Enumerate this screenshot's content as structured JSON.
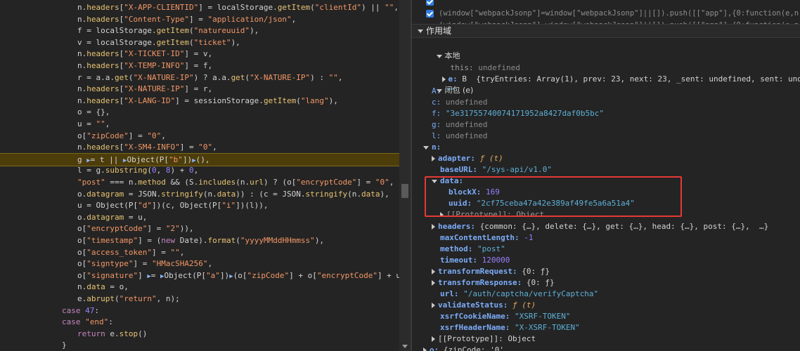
{
  "code": {
    "lines": [
      {
        "indent": 110,
        "text": "n.headers[\"X-APP-CLIENTID\"] = localStorage.getItem(\"clientId\") || \"\","
      },
      {
        "indent": 110,
        "text": "n.headers[\"Content-Type\"] = \"application/json\","
      },
      {
        "indent": 110,
        "text": "f = localStorage.getItem(\"natureuuid\"),"
      },
      {
        "indent": 110,
        "text": "v = localStorage.getItem(\"ticket\"),"
      },
      {
        "indent": 110,
        "text": "n.headers[\"X-TICKET-ID\"] = v,"
      },
      {
        "indent": 110,
        "text": "n.headers[\"X-TEMP-INFO\"] = f,"
      },
      {
        "indent": 110,
        "text": "r = a.a.get(\"X-NATURE-IP\") ? a.a.get(\"X-NATURE-IP\") : \"\","
      },
      {
        "indent": 110,
        "text": "n.headers[\"X-NATURE-IP\"] = r,"
      },
      {
        "indent": 110,
        "text": "n.headers[\"X-LANG-ID\"] = sessionStorage.getItem(\"lang\"),"
      },
      {
        "indent": 110,
        "text": "o = {},"
      },
      {
        "indent": 110,
        "text": "u = \"\","
      },
      {
        "indent": 110,
        "text": "o[\"zipCode\"] = \"0\","
      },
      {
        "indent": 110,
        "text": "n.headers[\"X-SM4-INFO\"] = \"0\","
      },
      {
        "indent": 110,
        "text": "g ▶= t || ▶Object(P[\"b\"])▶(),",
        "highlight": true
      },
      {
        "indent": 110,
        "text": "l = g.substring(0, 8) + 0,"
      },
      {
        "indent": 110,
        "text": "\"post\" === n.method && (S.includes(n.url) ? (o[\"encryptCode\"] = \"0\","
      },
      {
        "indent": 110,
        "text": "o.datagram = JSON.stringify(n.data)) : (c = JSON.stringify(n.data),"
      },
      {
        "indent": 110,
        "text": "u = Object(P[\"d\"])(c, Object(P[\"i\"])(l)),"
      },
      {
        "indent": 110,
        "text": "o.datagram = u,"
      },
      {
        "indent": 110,
        "text": "o[\"encryptCode\"] = \"2\")),"
      },
      {
        "indent": 110,
        "text": "o[\"timestamp\"] = (new Date).format(\"yyyyMMddHHmmss\"),"
      },
      {
        "indent": 110,
        "text": "o[\"access_token\"] = \"\","
      },
      {
        "indent": 110,
        "text": "o[\"signtype\"] = \"HMacSHA256\","
      },
      {
        "indent": 110,
        "text": "o[\"signature\"] ▶= ▶Object(P[\"a\"])▶(o[\"zipCode\"] + o[\"encryptCode\"] + u + o"
      },
      {
        "indent": 110,
        "text": "n.data = o,"
      },
      {
        "indent": 110,
        "text": "e.abrupt(\"return\", n);"
      },
      {
        "indent": 88,
        "text": "case 47:"
      },
      {
        "indent": 88,
        "text": "case \"end\":"
      },
      {
        "indent": 110,
        "text": "return e.stop()"
      },
      {
        "indent": 88,
        "text": "}"
      }
    ]
  },
  "breakpoints": [
    "(window[\"webpackJsonp\"]=window[\"webpackJsonp\"]||[]).push([[\"app\"],{0:function(e,n,A){e",
    "(window[\"webpackJsonp\"]=window[\"webpackJsonp\"]||[]).push([[\"app\"],{0:function(e,n,A){e"
  ],
  "scope": {
    "header": "作用域",
    "local": {
      "label": "本地",
      "this_key": "this:",
      "this_val": "undefined",
      "e_key": "e:",
      "e_val": "B  {tryEntries: Array(1), prev: 23, next: 23, _sent: undefined, sent: undefined,  …"
    },
    "closure": {
      "label": "闭包 (e)",
      "A_key": "A:",
      "A_val": "\"\"",
      "c_key": "c:",
      "c_val": "undefined",
      "f_key": "f:",
      "f_val": "\"3e31755740074171952a8427daf0b5bc\"",
      "g_key": "g:",
      "g_val": "undefined",
      "l_key": "l:",
      "l_val": "undefined",
      "n_key": "n:",
      "adapter_key": "adapter:",
      "adapter_val": "ƒ (t)",
      "baseURL_key": "baseURL:",
      "baseURL_val": "\"/sys-api/v1.0\"",
      "data_key": "data:",
      "blockX_key": "blockX:",
      "blockX_val": "169",
      "uuid_key": "uuid:",
      "uuid_val": "\"2cf75ceba47a42e389af49fe5a6a51a4\"",
      "proto_inner": "[[Prototype]]: Object",
      "headers_key": "headers:",
      "headers_val": "{common: {…}, delete: {…}, get: {…}, head: {…}, post: {…},  …}",
      "maxContentLength_key": "maxContentLength:",
      "maxContentLength_val": "-1",
      "method_key": "method:",
      "method_val": "\"post\"",
      "timeout_key": "timeout:",
      "timeout_val": "120000",
      "transformRequest_key": "transformRequest:",
      "transformRequest_val": "{0: ƒ}",
      "transformResponse_key": "transformResponse:",
      "transformResponse_val": "{0: ƒ}",
      "url_key": "url:",
      "url_val": "\"/auth/captcha/verifyCaptcha\"",
      "validateStatus_key": "validateStatus:",
      "validateStatus_val": "ƒ (t)",
      "xsrfCookieName_key": "xsrfCookieName:",
      "xsrfCookieName_val": "\"XSRF-TOKEN\"",
      "xsrfHeaderName_key": "xsrfHeaderName:",
      "xsrfHeaderName_val": "\"X-XSRF-TOKEN\"",
      "proto_outer": "[[Prototype]]: Object",
      "o_key": "o:",
      "o_val": "{zipCode: '0',"
    }
  },
  "colors": {
    "highlight_bg": "#4d3d0b",
    "annotation_box": "#e53935",
    "checkbox": "#2f7de1"
  }
}
